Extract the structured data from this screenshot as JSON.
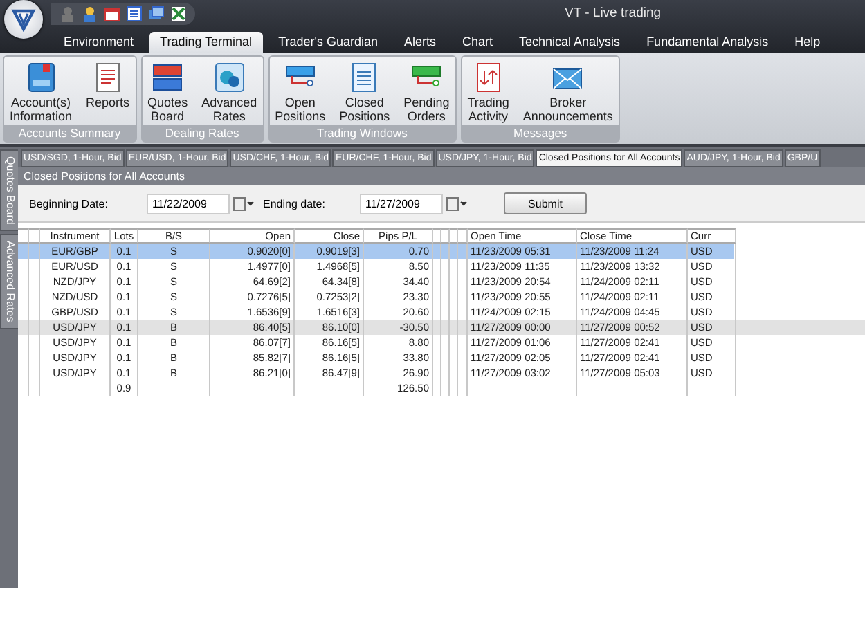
{
  "window": {
    "title": "VT - Live trading"
  },
  "menu_tabs": [
    {
      "label": "Environment",
      "selected": false
    },
    {
      "label": "Trading Terminal",
      "selected": true
    },
    {
      "label": "Trader's Guardian",
      "selected": false
    },
    {
      "label": "Alerts",
      "selected": false
    },
    {
      "label": "Chart",
      "selected": false
    },
    {
      "label": "Technical Analysis",
      "selected": false
    },
    {
      "label": "Fundamental Analysis",
      "selected": false
    },
    {
      "label": "Help",
      "selected": false
    }
  ],
  "ribbon_groups": [
    {
      "label": "Accounts Summary",
      "buttons": [
        {
          "label": "Account(s) Information",
          "kind": "account"
        },
        {
          "label": "Reports",
          "kind": "report"
        }
      ]
    },
    {
      "label": "Dealing Rates",
      "buttons": [
        {
          "label": "Quotes Board",
          "kind": "quotes"
        },
        {
          "label": "Advanced Rates",
          "kind": "rates"
        }
      ]
    },
    {
      "label": "Trading Windows",
      "buttons": [
        {
          "label": "Open Positions",
          "kind": "open"
        },
        {
          "label": "Closed Positions",
          "kind": "closed"
        },
        {
          "label": "Pending Orders",
          "kind": "pending"
        }
      ]
    },
    {
      "label": "Messages",
      "buttons": [
        {
          "label": "Trading Activity",
          "kind": "activity"
        },
        {
          "label": "Broker Announcements",
          "kind": "mail"
        }
      ]
    }
  ],
  "document_tabs": [
    {
      "label": "USD/SGD, 1-Hour, Bid",
      "selected": false
    },
    {
      "label": "EUR/USD, 1-Hour, Bid",
      "selected": false
    },
    {
      "label": "USD/CHF, 1-Hour, Bid",
      "selected": false
    },
    {
      "label": "EUR/CHF, 1-Hour, Bid",
      "selected": false
    },
    {
      "label": "USD/JPY, 1-Hour, Bid",
      "selected": false
    },
    {
      "label": "Closed Positions for All Accounts",
      "selected": true
    },
    {
      "label": "AUD/JPY, 1-Hour, Bid",
      "selected": false
    },
    {
      "label": "GBP/U",
      "selected": false
    }
  ],
  "side_tabs": [
    "Quotes Board",
    "Advanced Rates"
  ],
  "panel": {
    "title": "Closed Positions for All Accounts",
    "beginning_date": {
      "label": "Beginning Date:",
      "value": "11/22/2009"
    },
    "ending_date": {
      "label": "Ending date:",
      "value": "11/27/2009"
    },
    "submit": "Submit",
    "table": {
      "columns": [
        "Instrument",
        "Lots",
        "B/S",
        "Open",
        "Close",
        "Pips P/L",
        "Open Time",
        "Close Time",
        "Curr"
      ],
      "rows": [
        {
          "cells": [
            "EUR/GBP",
            "0.1",
            "S",
            "0.9020[0]",
            "0.9019[3]",
            "0.70",
            "11/23/2009 05:31",
            "11/23/2009 11:24",
            "USD"
          ],
          "selected": true,
          "highlighted": false
        },
        {
          "cells": [
            "EUR/USD",
            "0.1",
            "S",
            "1.4977[0]",
            "1.4968[5]",
            "8.50",
            "11/23/2009 11:35",
            "11/23/2009 13:32",
            "USD"
          ],
          "selected": false,
          "highlighted": false
        },
        {
          "cells": [
            "NZD/JPY",
            "0.1",
            "S",
            "64.69[2]",
            "64.34[8]",
            "34.40",
            "11/23/2009 20:54",
            "11/24/2009 02:11",
            "USD"
          ],
          "selected": false,
          "highlighted": false
        },
        {
          "cells": [
            "NZD/USD",
            "0.1",
            "S",
            "0.7276[5]",
            "0.7253[2]",
            "23.30",
            "11/23/2009 20:55",
            "11/24/2009 02:11",
            "USD"
          ],
          "selected": false,
          "highlighted": false
        },
        {
          "cells": [
            "GBP/USD",
            "0.1",
            "S",
            "1.6536[9]",
            "1.6516[3]",
            "20.60",
            "11/24/2009 02:15",
            "11/24/2009 04:45",
            "USD"
          ],
          "selected": false,
          "highlighted": false
        },
        {
          "cells": [
            "USD/JPY",
            "0.1",
            "B",
            "86.40[5]",
            "86.10[0]",
            "-30.50",
            "11/27/2009 00:00",
            "11/27/2009 00:52",
            "USD"
          ],
          "selected": false,
          "highlighted": true
        },
        {
          "cells": [
            "USD/JPY",
            "0.1",
            "B",
            "86.07[7]",
            "86.16[5]",
            "8.80",
            "11/27/2009 01:06",
            "11/27/2009 02:41",
            "USD"
          ],
          "selected": false,
          "highlighted": false
        },
        {
          "cells": [
            "USD/JPY",
            "0.1",
            "B",
            "85.82[7]",
            "86.16[5]",
            "33.80",
            "11/27/2009 02:05",
            "11/27/2009 02:41",
            "USD"
          ],
          "selected": false,
          "highlighted": false
        },
        {
          "cells": [
            "USD/JPY",
            "0.1",
            "B",
            "86.21[0]",
            "86.47[9]",
            "26.90",
            "11/27/2009 03:02",
            "11/27/2009 05:03",
            "USD"
          ],
          "selected": false,
          "highlighted": false
        }
      ],
      "totals": {
        "lots": "0.9",
        "pips": "126.50"
      }
    }
  }
}
